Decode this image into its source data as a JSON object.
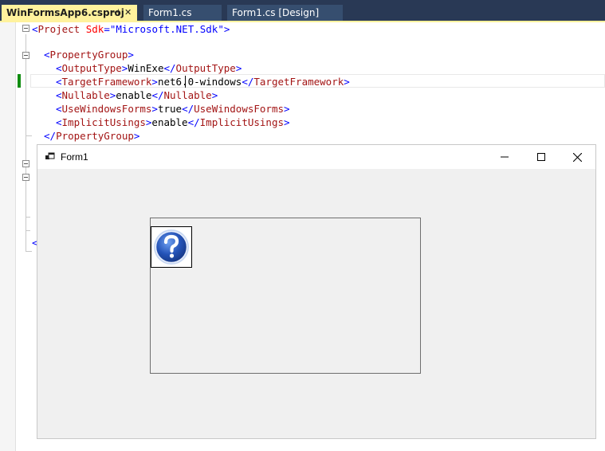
{
  "tabs": {
    "active": {
      "label": "WinFormsApp6.csproj",
      "pin_glyph": "⊣",
      "close_glyph": "✕"
    },
    "others": [
      {
        "label": "Form1.cs"
      },
      {
        "label": "Form1.cs [Design]"
      }
    ]
  },
  "editor": {
    "line1": {
      "open": "<",
      "tag": "Project",
      "attr": " Sdk",
      "eq": "=",
      "value": "\"Microsoft.NET.Sdk\"",
      "close": ">"
    },
    "line3": {
      "open": "<",
      "tag": "PropertyGroup",
      "close": ">"
    },
    "line4": {
      "open": "<",
      "tag": "OutputType",
      "close": ">",
      "text": "WinExe",
      "end_open": "</",
      "end_tag": "OutputType",
      "end_close": ">"
    },
    "line5": {
      "open": "<",
      "tag": "TargetFramework",
      "close": ">",
      "text": "net6.0-windows",
      "end_open": "</",
      "end_tag": "TargetFramework",
      "end_close": ">"
    },
    "line6": {
      "open": "<",
      "tag": "Nullable",
      "close": ">",
      "text": "enable",
      "end_open": "</",
      "end_tag": "Nullable",
      "end_close": ">"
    },
    "line7": {
      "open": "<",
      "tag": "UseWindowsForms",
      "close": ">",
      "text": "true",
      "end_open": "</",
      "end_tag": "UseWindowsForms",
      "end_close": ">"
    },
    "line8": {
      "open": "<",
      "tag": "ImplicitUsings",
      "close": ">",
      "text": "enable",
      "end_open": "</",
      "end_tag": "ImplicitUsings",
      "end_close": ">"
    },
    "line9": {
      "end_open": "</",
      "tag": "PropertyGroup",
      "close": ">"
    },
    "partial_bracket": "<"
  },
  "form": {
    "title": "Form1",
    "icon": "form-icon",
    "buttons": {
      "minimize": "minimize-icon",
      "maximize": "maximize-icon",
      "close": "close-icon"
    },
    "picturebox_icon": "question-mark-icon"
  },
  "colors": {
    "tab_strip": "#293955",
    "active_tab": "#fff29d",
    "xml_tag": "#a31515",
    "xml_bracket": "#0000ff",
    "xml_attr": "#ff0000",
    "change_marker": "#108d10",
    "form_background": "#f0f0f0"
  }
}
